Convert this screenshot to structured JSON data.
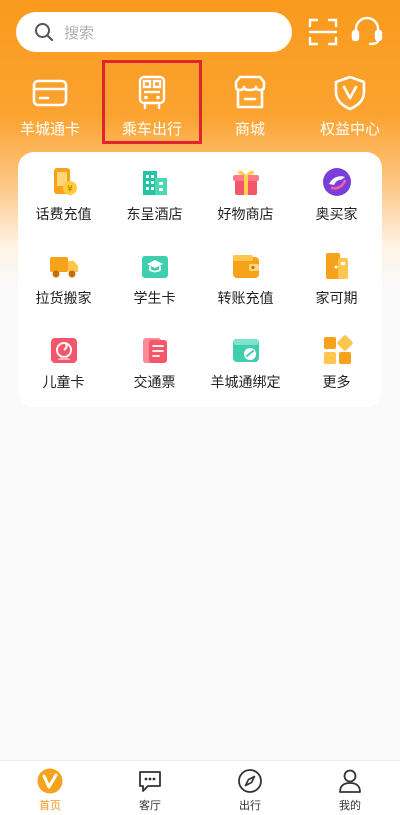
{
  "search": {
    "placeholder": "搜索"
  },
  "header_icons": {
    "scan": "scan-icon",
    "service": "headset-icon"
  },
  "quick_actions": [
    {
      "label": "羊城通卡",
      "icon": "card-icon"
    },
    {
      "label": "乘车出行",
      "icon": "bus-qr-icon",
      "highlighted": true
    },
    {
      "label": "商城",
      "icon": "shop-icon"
    },
    {
      "label": "权益中心",
      "icon": "shield-v-icon"
    }
  ],
  "services": [
    {
      "label": "话费充值",
      "icon": "phone-recharge-icon"
    },
    {
      "label": "东呈酒店",
      "icon": "hotel-icon"
    },
    {
      "label": "好物商店",
      "icon": "gift-icon"
    },
    {
      "label": "奥买家",
      "icon": "aomaijia-icon"
    },
    {
      "label": "拉货搬家",
      "icon": "truck-icon"
    },
    {
      "label": "学生卡",
      "icon": "student-card-icon"
    },
    {
      "label": "转账充值",
      "icon": "wallet-icon"
    },
    {
      "label": "家可期",
      "icon": "home-door-icon"
    },
    {
      "label": "儿童卡",
      "icon": "kids-card-icon"
    },
    {
      "label": "交通票",
      "icon": "ticket-icon"
    },
    {
      "label": "羊城通绑定",
      "icon": "bind-link-icon"
    },
    {
      "label": "更多",
      "icon": "more-grid-icon"
    }
  ],
  "tabs": [
    {
      "label": "首页",
      "icon": "home-logo-icon",
      "active": true
    },
    {
      "label": "客厅",
      "icon": "chat-icon",
      "active": false
    },
    {
      "label": "出行",
      "icon": "compass-icon",
      "active": false
    },
    {
      "label": "我的",
      "icon": "user-icon",
      "active": false
    }
  ],
  "colors": {
    "brand": "#f99a1c",
    "highlight": "#e0242b",
    "active_tab": "#f59a1b"
  }
}
